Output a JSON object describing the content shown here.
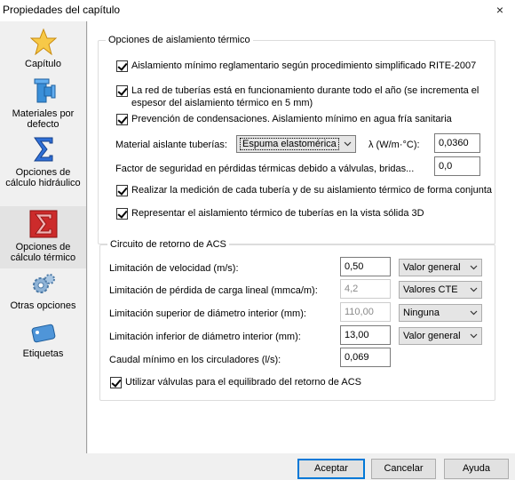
{
  "window": {
    "title": "Propiedades del capítulo",
    "close_label": "×"
  },
  "sidebar": {
    "items": [
      {
        "label": "Capítulo",
        "icon": "star-icon"
      },
      {
        "label": "Materiales por defecto",
        "icon": "pipe-icon"
      },
      {
        "label": "Opciones de cálculo hidráulico",
        "icon": "sigma-icon"
      },
      {
        "label": "Opciones de cálculo térmico",
        "icon": "sigma-red-icon",
        "selected": true
      },
      {
        "label": "Otras opciones",
        "icon": "gears-icon"
      },
      {
        "label": "Etiquetas",
        "icon": "tag-icon"
      }
    ]
  },
  "thermal": {
    "title": "Opciones de aislamiento térmico",
    "options": [
      {
        "label": "Aislamiento mínimo reglamentario según procedimiento simplificado RITE-2007",
        "checked": true
      },
      {
        "label": "La red de tuberías está en funcionamiento durante todo el año (se incrementa el",
        "label2": "espesor del aislamiento térmico en 5 mm)",
        "checked": true
      },
      {
        "label": "Prevención de condensaciones. Aislamiento mínimo en agua fría sanitaria",
        "checked": true
      }
    ],
    "material_label": "Material aislante tuberías:",
    "material_value": "Espuma elastomérica",
    "lambda_label": "λ (W/m·°C):",
    "lambda_value": "0,0360",
    "factor_label": "Factor de seguridad en pérdidas térmicas debido a válvulas, bridas...",
    "factor_value": "0,0",
    "options2": [
      {
        "label": "Realizar la medición de cada tubería y de su aislamiento térmico de forma conjunta",
        "checked": true
      },
      {
        "label": "Representar el aislamiento térmico de tuberías en la vista sólida 3D",
        "checked": true
      }
    ]
  },
  "acs": {
    "title": "Circuito de retorno de ACS",
    "rows": [
      {
        "label": "Limitación de velocidad (m/s):",
        "value": "0,50",
        "disabled": false,
        "select": "Valor general"
      },
      {
        "label": "Limitación de pérdida de carga lineal (mmca/m):",
        "value": "4,2",
        "disabled": true,
        "select": "Valores CTE"
      },
      {
        "label": "Limitación superior de diámetro interior (mm):",
        "value": "110,00",
        "disabled": true,
        "select": "Ninguna"
      },
      {
        "label": "Limitación inferior de diámetro interior (mm):",
        "value": "13,00",
        "disabled": false,
        "select": "Valor general"
      },
      {
        "label": "Caudal mínimo en los circuladores (l/s):",
        "value": "0,069",
        "disabled": false
      }
    ],
    "valves_label": "Utilizar válvulas para el equilibrado del retorno de ACS",
    "valves_checked": true
  },
  "buttons": {
    "accept": "Aceptar",
    "cancel": "Cancelar",
    "help": "Ayuda"
  }
}
